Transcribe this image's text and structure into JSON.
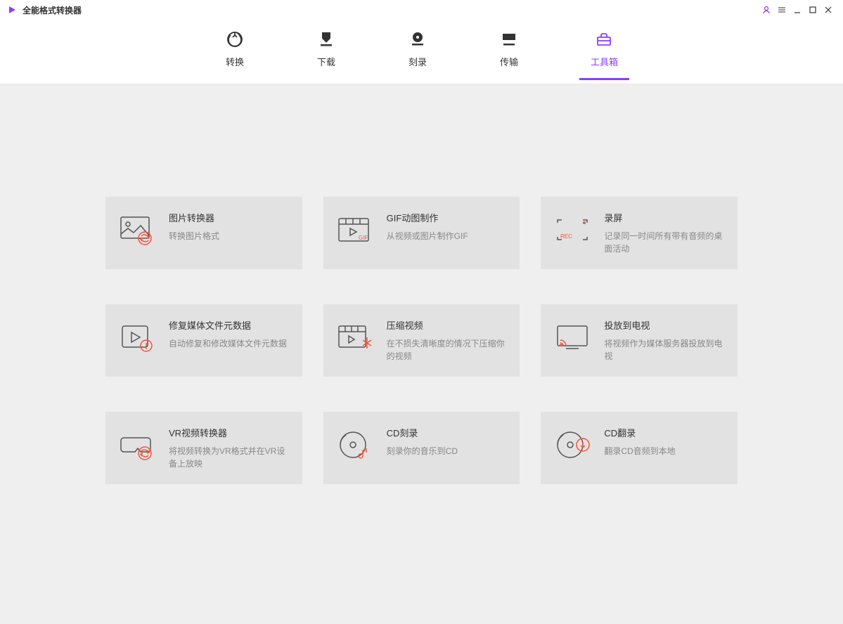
{
  "app_name": "全能格式转换器",
  "tabs": {
    "convert": "转换",
    "download": "下载",
    "burn": "刻录",
    "transfer": "传输",
    "toolbox": "工具箱"
  },
  "tools": {
    "image_converter": {
      "title": "图片转换器",
      "desc": "转换图片格式"
    },
    "gif_maker": {
      "title": "GIF动图制作",
      "desc": "从视频或图片制作GIF"
    },
    "screen_record": {
      "title": "录屏",
      "desc": "记录同一时间所有带有音频的桌面活动"
    },
    "fix_metadata": {
      "title": "修复媒体文件元数据",
      "desc": "自动修复和修改媒体文件元数据"
    },
    "compress": {
      "title": "压缩视频",
      "desc": "在不损失清晰度的情况下压缩你的视频"
    },
    "cast_tv": {
      "title": "投放到电视",
      "desc": "将视频作为媒体服务器投放到电视"
    },
    "vr_converter": {
      "title": "VR视频转换器",
      "desc": "将视频转换为VR格式并在VR设备上放映"
    },
    "cd_burn": {
      "title": "CD刻录",
      "desc": "刻录你的音乐到CD"
    },
    "cd_rip": {
      "title": "CD翻录",
      "desc": "翻录CD音频到本地"
    }
  }
}
